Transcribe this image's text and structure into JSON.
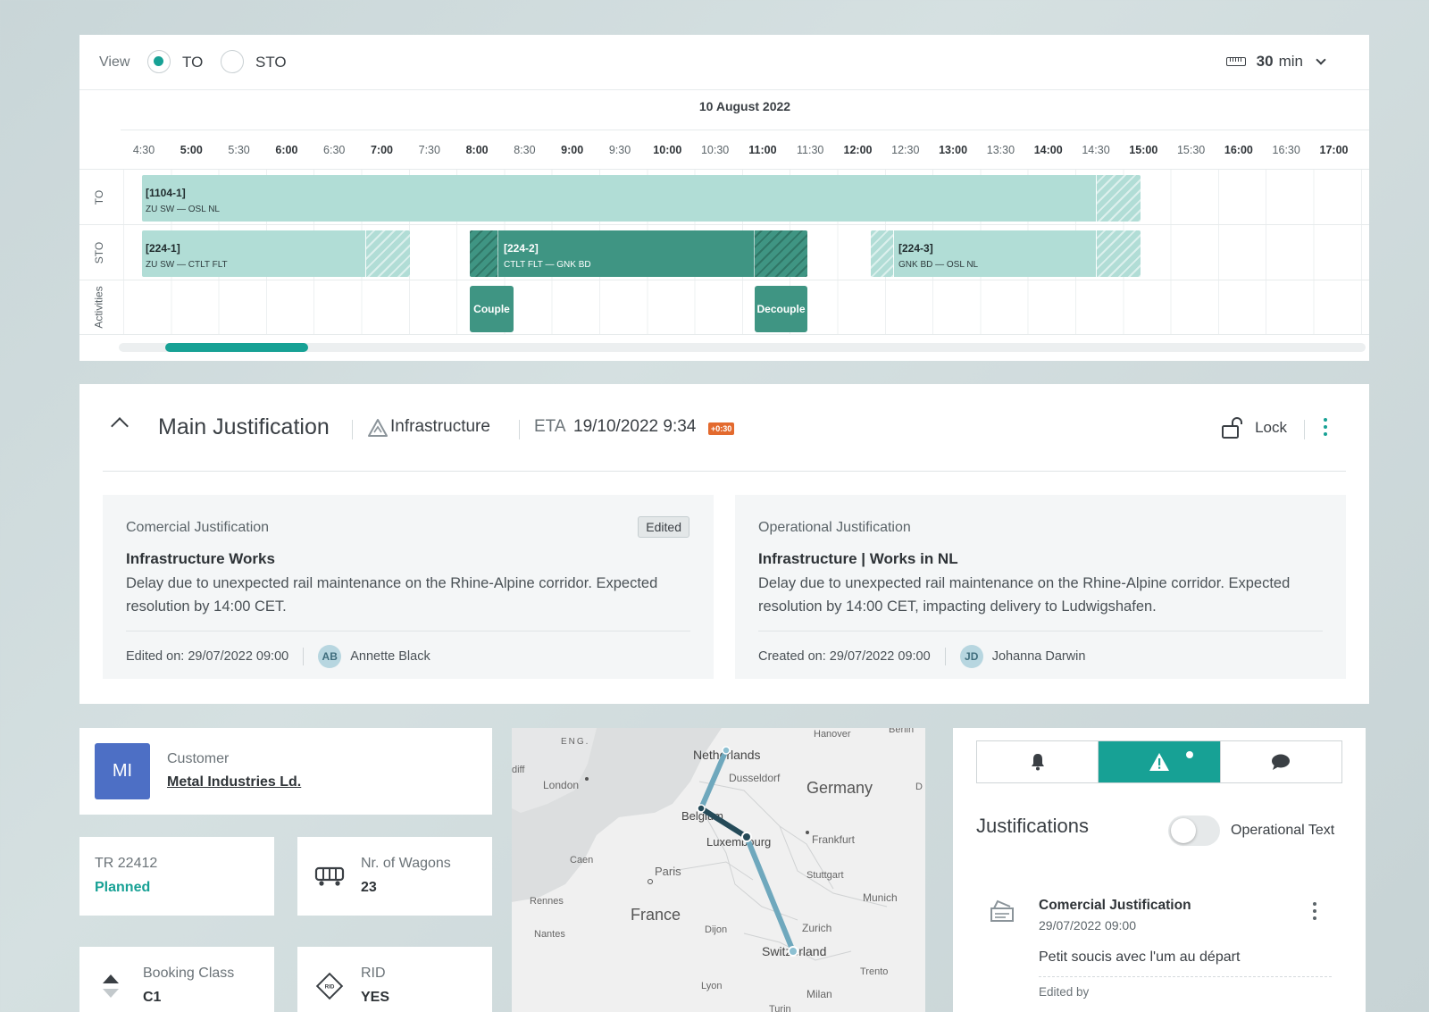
{
  "timeline": {
    "view_label": "View",
    "radio_to": "TO",
    "radio_sto": "STO",
    "selected_view": "TO",
    "interval_value": "30",
    "interval_unit": "min",
    "date": "10 August 2022",
    "ticks": [
      "4:30",
      "5:00",
      "5:30",
      "6:00",
      "6:30",
      "7:00",
      "7:30",
      "8:00",
      "8:30",
      "9:00",
      "9:30",
      "10:00",
      "10:30",
      "11:00",
      "11:30",
      "12:00",
      "12:30",
      "13:00",
      "13:30",
      "14:00",
      "14:30",
      "15:00",
      "15:30",
      "16:00",
      "16:30",
      "17:00"
    ],
    "lanes": {
      "to": "TO",
      "sto": "STO",
      "activities": "Activities"
    },
    "to_bar": {
      "id": "[1104-1]",
      "route": "ZU SW — OSL NL"
    },
    "sto_bars": [
      {
        "id": "[224-1]",
        "route": "ZU SW — CTLT FLT"
      },
      {
        "id": "[224-2]",
        "route": "CTLT FLT — GNK BD"
      },
      {
        "id": "[224-3]",
        "route": "GNK BD — OSL NL"
      }
    ],
    "activities": [
      "Couple",
      "Decouple"
    ]
  },
  "justification": {
    "title": "Main Justification",
    "category": "Infrastructure",
    "eta_label": "ETA",
    "eta_value": "19/10/2022 9:34",
    "delay_badge": "+0:30",
    "lock_label": "Lock",
    "commercial": {
      "title": "Comercial Justification",
      "badge": "Edited",
      "heading": "Infrastructure Works",
      "body": "Delay due to unexpected rail maintenance on the Rhine-Alpine corridor. Expected resolution by 14:00 CET.",
      "footer_date": "Edited on: 29/07/2022  09:00",
      "user_initials": "AB",
      "user_name": "Annette Black"
    },
    "operational": {
      "title": "Operational Justification",
      "heading": "Infrastructure | Works in NL",
      "body": "Delay due to unexpected rail maintenance on the Rhine-Alpine corridor. Expected resolution by 14:00 CET, impacting delivery to Ludwigshafen.",
      "footer_date": "Created on: 29/07/2022  09:00",
      "user_initials": "JD",
      "user_name": "Johanna Darwin"
    }
  },
  "customer": {
    "initials": "MI",
    "label": "Customer",
    "name": "Metal Industries Ld."
  },
  "train": {
    "label": "TR 22412",
    "status": "Planned"
  },
  "wagons": {
    "label": "Nr. of Wagons",
    "value": "23"
  },
  "booking": {
    "label": "Booking Class",
    "value": "C1"
  },
  "rid": {
    "label": "RID",
    "value": "YES"
  },
  "map": {
    "labels": [
      "ENG.",
      "London",
      "Netherlands",
      "Dusseldorf",
      "Germany",
      "Hanover",
      "Berlin",
      "Belgium",
      "Luxembourg",
      "Frankfurt",
      "Caen",
      "Paris",
      "Stuttgart",
      "Rennes",
      "France",
      "Munich",
      "Nantes",
      "Dijon",
      "Zurich",
      "Switzerland",
      "Trento",
      "Lyon",
      "Milan",
      "Turin",
      "diff",
      "D"
    ]
  },
  "sidepanel": {
    "tabs": [
      "bell-icon",
      "warning-icon",
      "chat-icon"
    ],
    "active_tab": 1,
    "title": "Justifications",
    "toggle_label": "Operational Text",
    "entry": {
      "title": "Comercial Justification",
      "date": "29/07/2022  09:00",
      "text": "Petit soucis avec l'um au départ",
      "edited": "Edited by"
    }
  }
}
